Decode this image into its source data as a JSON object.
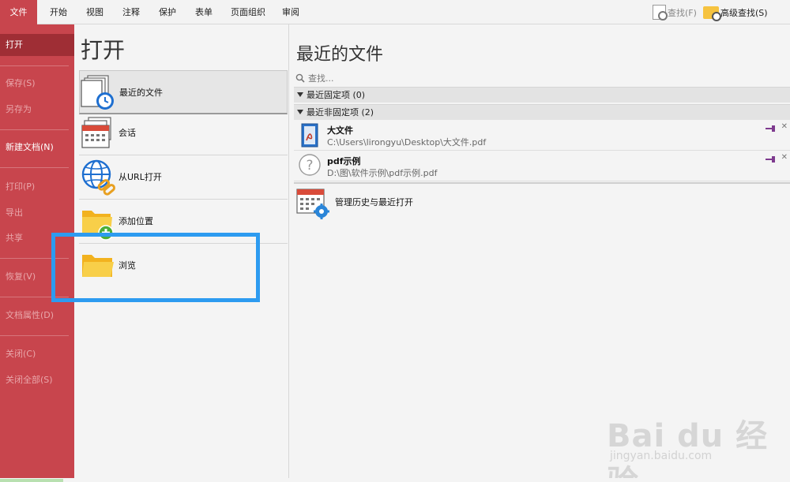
{
  "ribbon": {
    "tabs": [
      {
        "label": "文件",
        "active": true
      },
      {
        "label": "开始"
      },
      {
        "label": "视图"
      },
      {
        "label": "注释"
      },
      {
        "label": "保护"
      },
      {
        "label": "表单"
      },
      {
        "label": "页面组织"
      },
      {
        "label": "审阅"
      }
    ],
    "find_label": "查找(F)",
    "advanced_find_label": "高级查找(S)"
  },
  "nav": {
    "items": [
      {
        "label": "打开",
        "state": "selected"
      },
      {
        "label": "保存(S)",
        "state": "disabled"
      },
      {
        "label": "另存为",
        "state": "disabled"
      },
      {
        "label": "新建文档(N)",
        "state": "enabled"
      },
      {
        "label": "打印(P)",
        "state": "disabled"
      },
      {
        "label": "导出",
        "state": "disabled"
      },
      {
        "label": "共享",
        "state": "disabled"
      },
      {
        "label": "恢复(V)",
        "state": "disabled"
      },
      {
        "label": "文档属性(D)",
        "state": "disabled"
      },
      {
        "label": "关闭(C)",
        "state": "disabled"
      },
      {
        "label": "关闭全部(S)",
        "state": "disabled"
      }
    ]
  },
  "open_panel": {
    "title": "打开",
    "items": [
      {
        "label": "最近的文件",
        "icon": "recent-files-icon",
        "selected": true
      },
      {
        "label": "会话",
        "icon": "session-icon"
      },
      {
        "label": "从URL打开",
        "icon": "globe-link-icon"
      },
      {
        "label": "添加位置",
        "icon": "add-folder-icon"
      },
      {
        "label": "浏览",
        "icon": "folder-icon"
      }
    ]
  },
  "recent": {
    "title": "最近的文件",
    "search_placeholder": "查找...",
    "pinned_header": "最近固定项 (0)",
    "unpinned_header": "最近非固定项 (2)",
    "files": [
      {
        "name": "大文件",
        "path": "C:\\Users\\lirongyu\\Desktop\\大文件.pdf",
        "icon": "pdf-file-icon"
      },
      {
        "name": "pdf示例",
        "path": "D:\\图\\软件示例\\pdf示例.pdf",
        "icon": "unknown-file-icon"
      }
    ],
    "manage_label": "管理历史与最近打开"
  },
  "watermark": {
    "brand": "Bai du 经验",
    "url": "jingyan.baidu.com"
  },
  "colors": {
    "accent": "#c8454d",
    "nav_selected": "#9f2e35",
    "highlight": "#2d9bf0"
  }
}
